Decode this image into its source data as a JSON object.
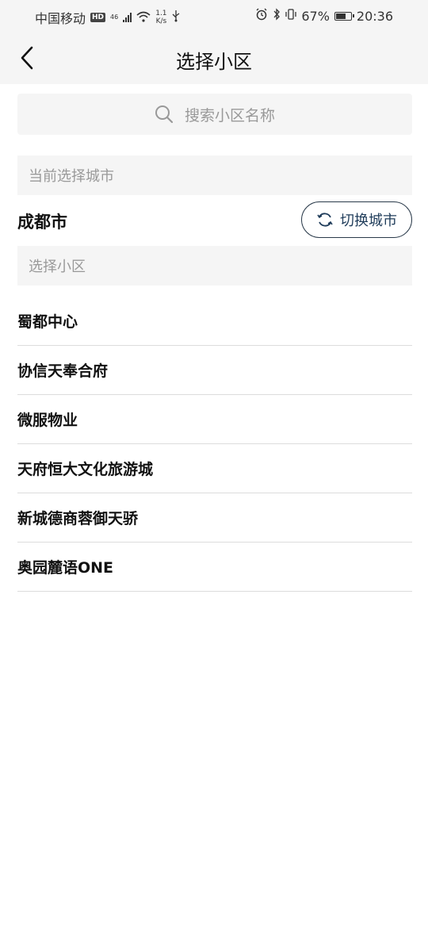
{
  "status_bar": {
    "carrier": "中国移动",
    "hd": "HD",
    "network": "46",
    "speed_value": "1.1",
    "speed_unit": "K/s",
    "battery": "67%",
    "time": "20:36"
  },
  "header": {
    "title": "选择小区",
    "back_icon": "chevron-left-icon"
  },
  "search": {
    "placeholder": "搜索小区名称",
    "icon": "search-icon"
  },
  "current_city_section": {
    "label": "当前选择城市",
    "city": "成都市",
    "switch_label": "切换城市",
    "switch_icon": "refresh-icon"
  },
  "community_section": {
    "label": "选择小区",
    "items": [
      {
        "name": "蜀都中心"
      },
      {
        "name": "协信天奉合府"
      },
      {
        "name": "微服物业"
      },
      {
        "name": "天府恒大文化旅游城"
      },
      {
        "name": "新城德商蓉御天骄"
      },
      {
        "name": "奥园麓语ONE"
      }
    ]
  },
  "colors": {
    "background": "#ffffff",
    "panel": "#f5f5f5",
    "placeholder_text": "#999999",
    "switch_button_text": "#1f3c5a",
    "divider": "#dcdcdc"
  }
}
